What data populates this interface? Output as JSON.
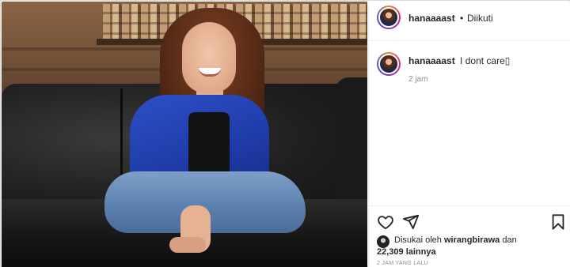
{
  "post": {
    "username": "hanaaaast",
    "separator": "•",
    "follow_status": "Diikuti"
  },
  "caption": {
    "username": "hanaaaast",
    "text": "I dont care▯",
    "time": "2 jam"
  },
  "icons": {
    "like": "heart-icon",
    "share": "paper-plane-icon",
    "save": "bookmark-icon"
  },
  "likes": {
    "prefix": "Disukai oleh",
    "user": "wirangbirawa",
    "conjunction": "dan",
    "count": "22,309 lainnya"
  },
  "timestamp": "2 JAM YANG LALU",
  "colors": {
    "border": "#dbdbdb",
    "text": "#262626",
    "muted": "#8e8e8e",
    "jacket_blue": "#1f3aa6"
  }
}
